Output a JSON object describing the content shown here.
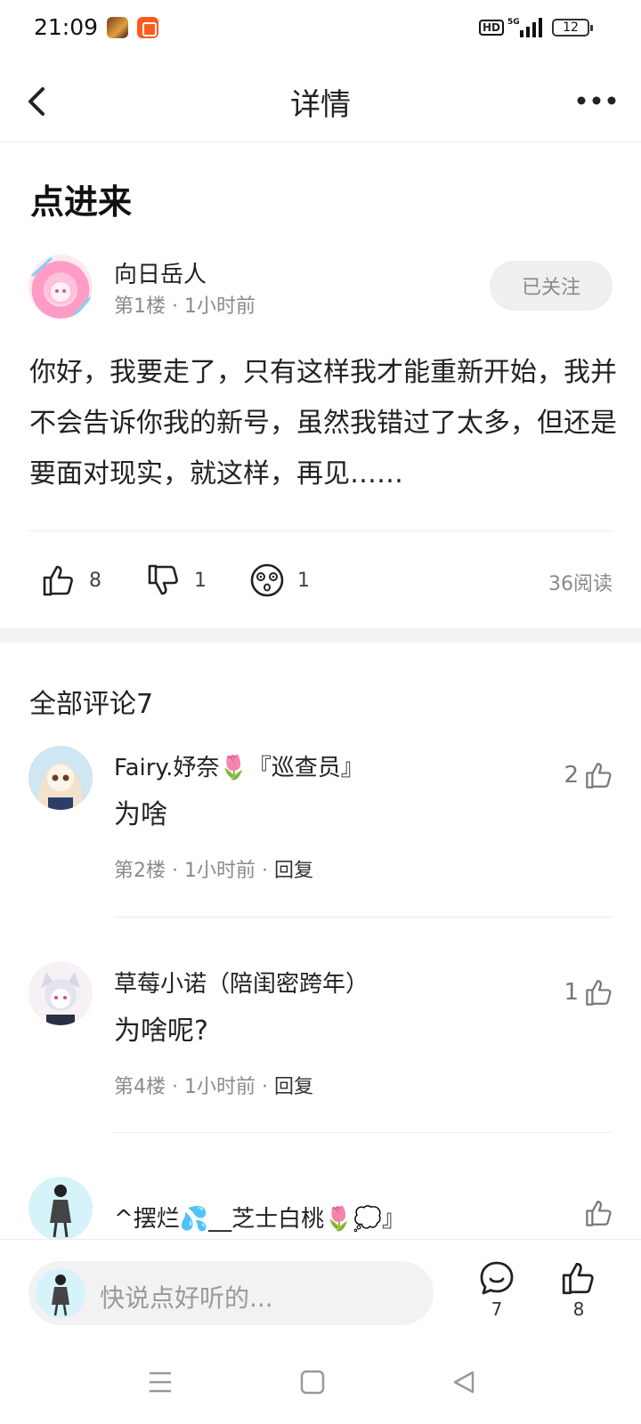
{
  "status_bar": {
    "time": "21:09",
    "network": "5G",
    "hd": "HD",
    "battery": "12"
  },
  "nav": {
    "title": "详情"
  },
  "post": {
    "title": "点进来",
    "author": "向日岳人",
    "floor": "第1楼",
    "time": "1小时前",
    "follow_label": "已关注",
    "body": "你好，我要走了，只有这样我才能重新开始，我并不会告诉你我的新号，虽然我错过了太多，但还是要面对现实，就这样，再见……",
    "likes": "8",
    "dislikes": "1",
    "emoji_count": "1",
    "reads": "36阅读"
  },
  "comments_header": "全部评论7",
  "comments": [
    {
      "name": "Fairy.妤奈🌷『巡查员』",
      "text": "为啥",
      "floor": "第2楼",
      "time": "1小时前",
      "reply": "回复",
      "likes": "2"
    },
    {
      "name": "草莓小诺（陪闺密跨年）",
      "text": "为啥呢?",
      "floor": "第4楼",
      "time": "1小时前",
      "reply": "回复",
      "likes": "1"
    },
    {
      "name": "^摆烂💦__芝士白桃🌷💭』",
      "likes": ""
    }
  ],
  "bottom_bar": {
    "placeholder": "快说点好听的...",
    "comment_count": "7",
    "like_count": "8"
  },
  "colors": {
    "muted_text": "#8a8a8a",
    "follow_bg": "#efefef",
    "battery": "#f5c400"
  },
  "icons": [
    "back-icon",
    "more-icon",
    "thumb-up-icon",
    "thumb-down-icon",
    "dizzy-face-icon",
    "comment-bubble-icon",
    "menu-icon",
    "home-square-icon",
    "back-triangle-icon"
  ]
}
